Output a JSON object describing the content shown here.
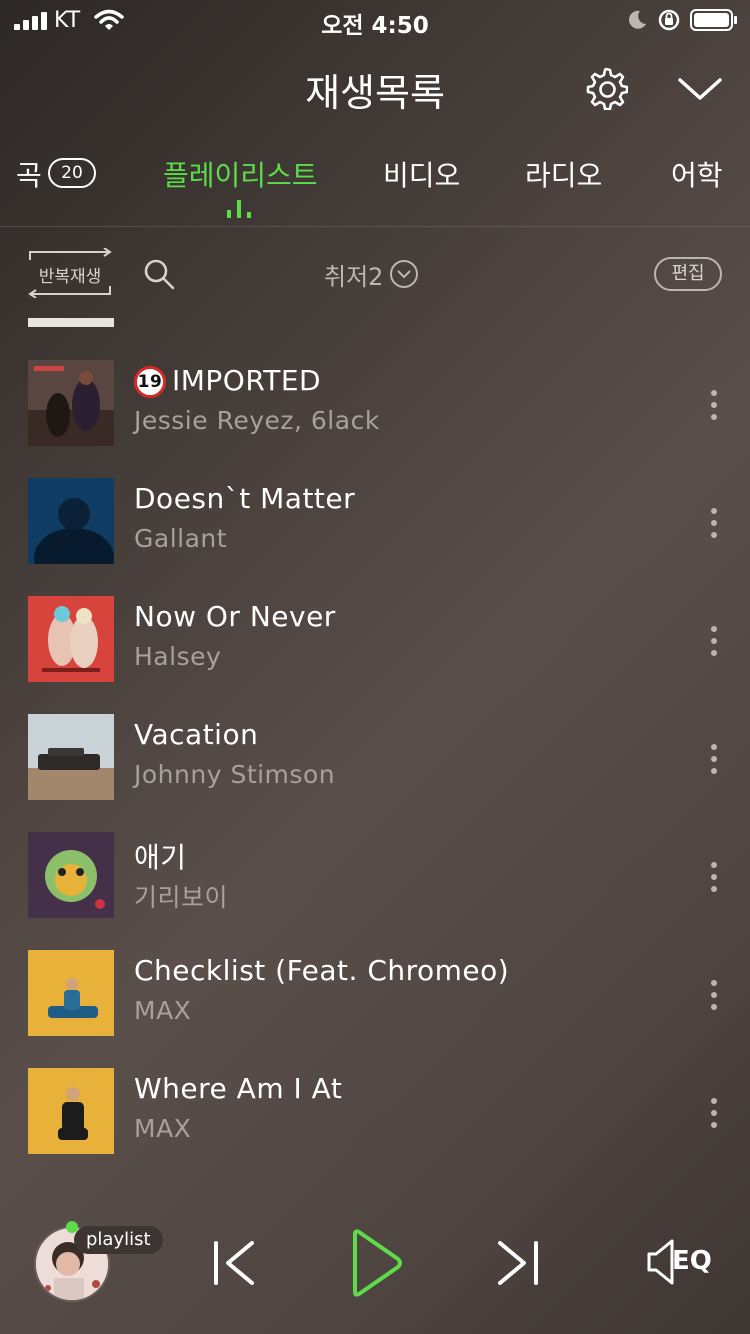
{
  "status_bar": {
    "carrier": "KT",
    "time": "오전 4:50"
  },
  "header": {
    "title": "재생목록"
  },
  "tabs": [
    {
      "label": "곡",
      "badge": "20"
    },
    {
      "label": "플레이리스트"
    },
    {
      "label": "비디오"
    },
    {
      "label": "라디오"
    },
    {
      "label": "어학"
    }
  ],
  "toolbar": {
    "repeat_label": "반복재생",
    "sort_label": "취저2",
    "edit_label": "편집"
  },
  "songs": [
    {
      "title": "IMPORTED",
      "artist": "Jessie Reyez, 6lack",
      "age_badge": "19"
    },
    {
      "title": "Doesn`t Matter",
      "artist": "Gallant"
    },
    {
      "title": "Now Or Never",
      "artist": "Halsey"
    },
    {
      "title": "Vacation",
      "artist": "Johnny Stimson"
    },
    {
      "title": "애기",
      "artist": "기리보이"
    },
    {
      "title": "Checklist (Feat. Chromeo)",
      "artist": "MAX"
    },
    {
      "title": "Where Am I At",
      "artist": "MAX"
    }
  ],
  "player": {
    "pill_label": "playlist",
    "eq_label": "EQ"
  },
  "colors": {
    "accent": "#5ddc4a",
    "age_badge_ring": "#d42a2a"
  },
  "icons": [
    "signal-icon",
    "wifi-icon",
    "moon-icon",
    "rotation-lock-icon",
    "battery-icon",
    "gear-icon",
    "chevron-down-icon",
    "search-icon",
    "chevron-circle-icon",
    "more-icon",
    "previous-icon",
    "play-icon",
    "next-icon",
    "speaker-icon"
  ]
}
